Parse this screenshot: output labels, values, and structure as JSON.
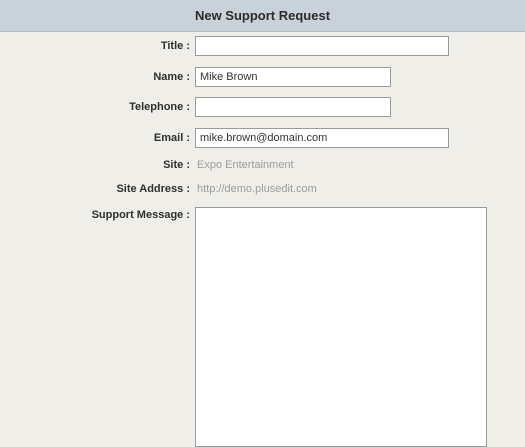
{
  "form": {
    "title": "New Support Request",
    "fields": {
      "title": {
        "label": "Title :",
        "value": ""
      },
      "name": {
        "label": "Name :",
        "value": "Mike Brown"
      },
      "telephone": {
        "label": "Telephone :",
        "value": ""
      },
      "email": {
        "label": "Email :",
        "value": "mike.brown@domain.com"
      },
      "site": {
        "label": "Site :",
        "value": "Expo Entertainment"
      },
      "site_address": {
        "label": "Site Address :",
        "value": "http://demo.plusedit.com"
      },
      "support_message": {
        "label": "Support Message :",
        "value": ""
      }
    }
  }
}
